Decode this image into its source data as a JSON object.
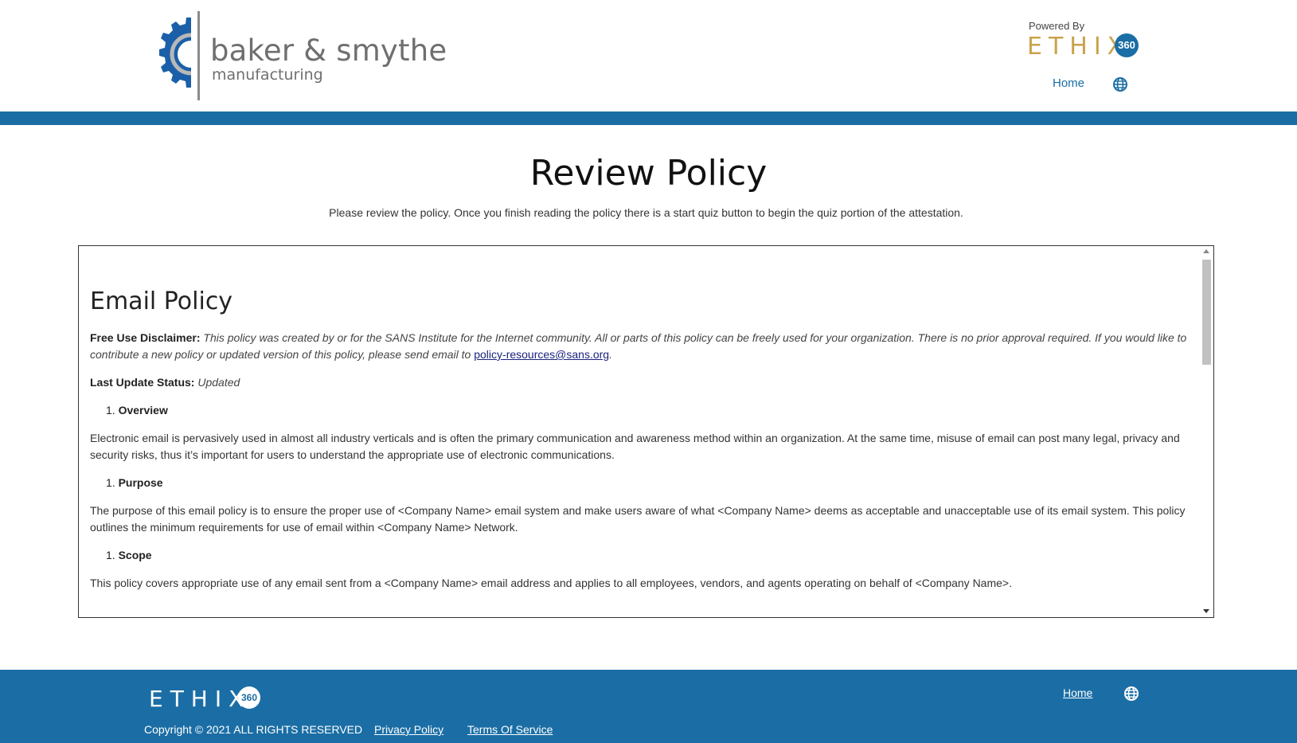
{
  "header": {
    "logo_name": "baker & smythe",
    "logo_sub": "manufacturing",
    "powered_label": "Powered By",
    "powered_brand": "ETHIX",
    "powered_badge": "360",
    "home_label": "Home",
    "globe_icon": "globe-icon"
  },
  "colors": {
    "primary_blue": "#1b6ea5",
    "gold": "#c9a24a",
    "link_dark": "#1a237e"
  },
  "main": {
    "title": "Review Policy",
    "description": "Please review the policy. Once you finish reading the policy there is a start quiz button to begin the quiz portion of the attestation."
  },
  "policy": {
    "title": "Email Policy",
    "disclaimer_label": "Free Use Disclaimer:",
    "disclaimer_text": " This policy was created by or for the SANS Institute for the Internet community. All or parts of this policy can be freely used for your organization. There is no prior approval required. If you would like to contribute a new policy or updated version of this policy, please send email to ",
    "disclaimer_email": "policy-resources@sans.org",
    "disclaimer_end": ".",
    "status_label": "Last Update Status:",
    "status_value": " Updated",
    "sections": [
      {
        "number": "1.",
        "heading": "Overview",
        "body": "Electronic email is pervasively used in almost all industry verticals and is often the primary communication and awareness method within an organization. At the same time, misuse of email can post many legal, privacy and security risks, thus it’s important for users to understand the appropriate use of electronic communications."
      },
      {
        "number": "1.",
        "heading": "Purpose",
        "body": "The purpose of this email policy is to ensure the proper use of <Company Name> email system and make users aware of what <Company Name> deems as acceptable and unacceptable use of its email system. This policy outlines the minimum requirements for use of email within <Company Name> Network."
      },
      {
        "number": "1.",
        "heading": "Scope",
        "body": "This policy covers appropriate use of any email sent from a <Company Name> email address and applies to all employees, vendors, and agents operating on behalf of <Company Name>."
      }
    ]
  },
  "footer": {
    "brand": "ETHIX",
    "badge": "360",
    "copyright": "Copyright © 2021 ALL RIGHTS RESERVED",
    "privacy_label": "Privacy Policy",
    "terms_label": "Terms Of Service",
    "home_label": "Home",
    "globe_icon": "globe-icon"
  }
}
